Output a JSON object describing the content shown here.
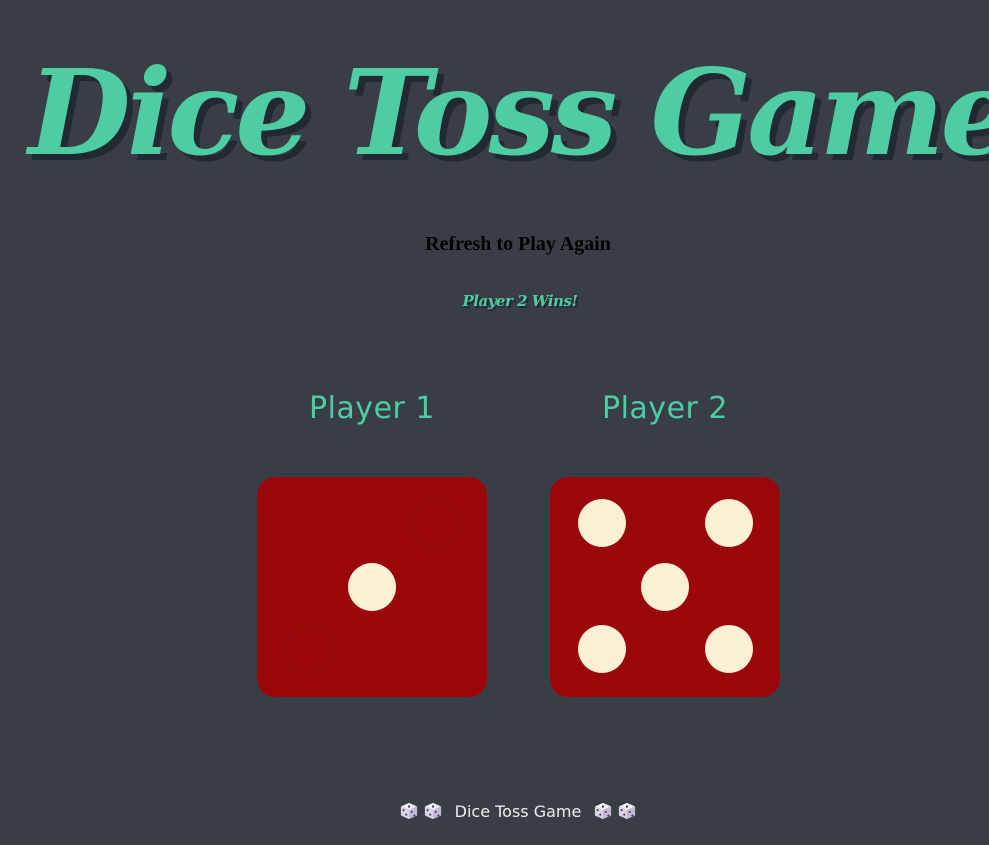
{
  "header": {
    "title": "Dice Toss Game",
    "instruction": "Refresh to Play Again",
    "result": "Player 2 Wins!"
  },
  "players": [
    {
      "label": "Player 1",
      "die_value": 1
    },
    {
      "label": "Player 2",
      "die_value": 5
    }
  ],
  "footer": {
    "text": "Dice Toss Game",
    "icon": "game-die-icon"
  },
  "colors": {
    "background": "#393e46",
    "accent": "#4ecca3",
    "die_face": "#9a070b",
    "pip": "#fbf0d4",
    "title_shadow": "#232931"
  }
}
